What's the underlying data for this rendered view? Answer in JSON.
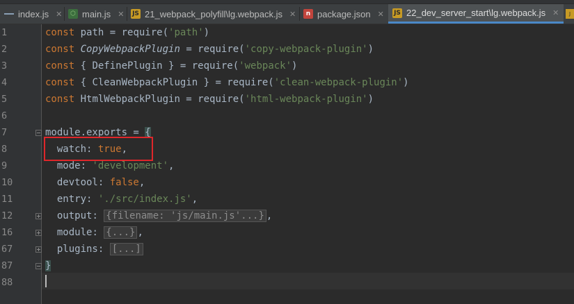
{
  "tabs": [
    {
      "label": "index.js",
      "icon": "structure-icon"
    },
    {
      "label": "main.js",
      "icon": "nodejs-icon"
    },
    {
      "label": "21_webpack_polyfill\\lg.webpack.js",
      "icon": "js-file-icon"
    },
    {
      "label": "package.json",
      "icon": "npm-package-icon"
    },
    {
      "label": "22_dev_server_start\\lg.webpack.js",
      "icon": "js-file-icon",
      "active": true
    }
  ],
  "close_glyph": "✕",
  "editor": {
    "line_numbers": [
      "1",
      "2",
      "3",
      "4",
      "5",
      "6",
      "7",
      "8",
      "9",
      "10",
      "11",
      "12",
      "16",
      "67",
      "87",
      "88"
    ],
    "lines": {
      "l1": {
        "a": "const",
        "b": " path = ",
        "c": "require",
        "d": "(",
        "e": "'path'",
        "f": ")"
      },
      "l2": {
        "a": "const",
        "b": " ",
        "c": "CopyWebpackPlugin",
        "d": " = require(",
        "e": "'copy-webpack-plugin'",
        "f": ")"
      },
      "l3": {
        "a": "const",
        "b": " { DefinePlugin } = require(",
        "e": "'webpack'",
        "f": ")"
      },
      "l4": {
        "a": "const",
        "b": " { CleanWebpackPlugin } = require(",
        "e": "'clean-webpack-plugin'",
        "f": ")"
      },
      "l5": {
        "a": "const",
        "b": " HtmlWebpackPlugin = require(",
        "e": "'html-webpack-plugin'",
        "f": ")"
      },
      "l7": {
        "a": "module.exports = ",
        "b": "{"
      },
      "l8": {
        "a": "  watch",
        "b": ": ",
        "c": "true",
        ",": ","
      },
      "l9": {
        "a": "  mode",
        "b": ": ",
        "c": "'development'",
        "d": ","
      },
      "l10": {
        "a": "  devtool",
        "b": ": ",
        "c": "false",
        "d": ","
      },
      "l11": {
        "a": "  entry",
        "b": ": ",
        "c": "'./src/index.js'",
        "d": ","
      },
      "l12": {
        "a": "  output",
        "b": ": ",
        "c": "{filename: 'js/main.js'...}",
        "d": ","
      },
      "l16": {
        "a": "  module",
        "b": ": ",
        "c": "{...}",
        "d": ","
      },
      "l67": {
        "a": "  plugins",
        "b": ": ",
        "c": "[...]"
      },
      "l87": {
        "a": "}"
      }
    }
  },
  "colors": {
    "keyword": "#cc7832",
    "string": "#6a8759",
    "highlight": "#e0262a",
    "accent": "#4a88c7"
  }
}
